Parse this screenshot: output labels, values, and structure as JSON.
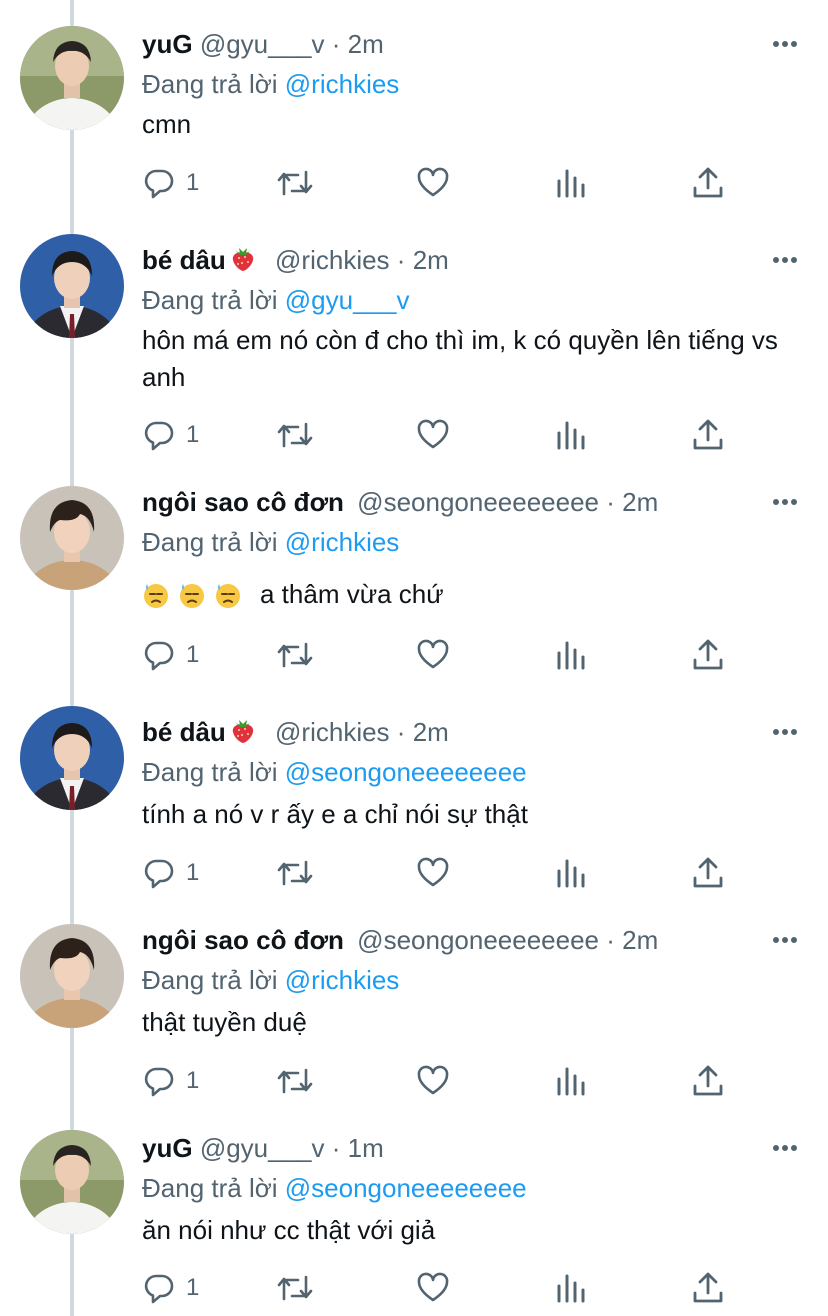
{
  "tweets": [
    {
      "name": "yuG",
      "handle": "@gyu___v",
      "dot": "·",
      "time": "2m",
      "replying_prefix": "Đang trả lời ",
      "replying_to": "@richkies",
      "text": "cmn",
      "reply_count": "1",
      "avatar": "avatar-white-shirt"
    },
    {
      "name": "bé dâu",
      "name_emoji": "strawberry-icon",
      "handle": "@richkies",
      "dot": "·",
      "time": "2m",
      "replying_prefix": "Đang trả lời ",
      "replying_to": "@gyu___v",
      "text": "hôn má em nó còn đ cho thì im, k có quyền lên tiếng vs anh",
      "reply_count": "1",
      "avatar": "avatar-school-uniform"
    },
    {
      "name": "ngôi sao cô đơn",
      "handle": "@seongoneeeeeeee",
      "dot": "·",
      "time": "2m",
      "replying_prefix": "Đang trả lời ",
      "replying_to": "@richkies",
      "text": "a thâm vừa chứ",
      "text_emojis": [
        "downcast-sweat-face-icon",
        "downcast-sweat-face-icon",
        "downcast-sweat-face-icon"
      ],
      "reply_count": "1",
      "avatar": "avatar-beige-top"
    },
    {
      "name": "bé dâu",
      "name_emoji": "strawberry-icon",
      "handle": "@richkies",
      "dot": "·",
      "time": "2m",
      "replying_prefix": "Đang trả lời ",
      "replying_to": "@seongoneeeeeeee",
      "text": "tính a nó v r ấy e a chỉ nói sự thật",
      "reply_count": "1",
      "avatar": "avatar-school-uniform"
    },
    {
      "name": "ngôi sao cô đơn",
      "handle": "@seongoneeeeeeee",
      "dot": "·",
      "time": "2m",
      "replying_prefix": "Đang trả lời ",
      "replying_to": "@richkies",
      "text": "thật tuyền duệ",
      "reply_count": "1",
      "avatar": "avatar-beige-top"
    },
    {
      "name": "yuG",
      "handle": "@gyu___v",
      "dot": "·",
      "time": "1m",
      "replying_prefix": "Đang trả lời ",
      "replying_to": "@seongoneeeeeeee",
      "text": "ăn nói như cc thật với giả",
      "reply_count": "1",
      "avatar": "avatar-white-shirt"
    }
  ],
  "action_icons": [
    "reply-icon",
    "retweet-icon",
    "like-icon",
    "analytics-icon",
    "share-icon"
  ],
  "colors": {
    "link": "#1d9bf0",
    "secondary_text": "#536471",
    "primary_text": "#0f1419",
    "thread_line": "#cfd9de"
  }
}
